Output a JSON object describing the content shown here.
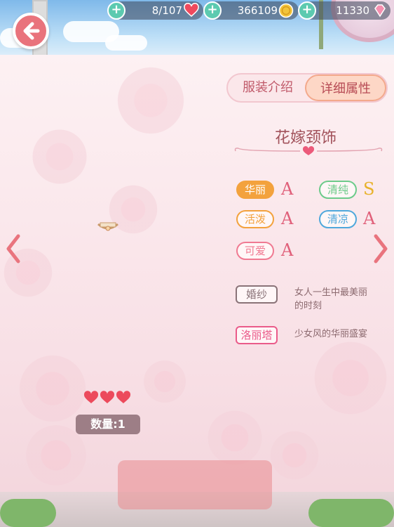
{
  "resources": {
    "stamina": "8/107",
    "coins": "366109",
    "diamonds": "11330"
  },
  "tabs": [
    {
      "label": "服装介绍",
      "active": false
    },
    {
      "label": "详细属性",
      "active": true
    }
  ],
  "item": {
    "name": "花嫁颈饰",
    "quantity_label": "数量:1",
    "hearts": 3
  },
  "attributes": [
    {
      "label": "华丽",
      "grade": "A",
      "color": "#f3a23d",
      "grade_color": "#e0607a"
    },
    {
      "label": "清纯",
      "grade": "S",
      "color": "#6ccb8a",
      "grade_color": "#e8b22a"
    },
    {
      "label": "活泼",
      "grade": "A",
      "color": "#f3a23d",
      "grade_color": "#e0607a"
    },
    {
      "label": "清凉",
      "grade": "A",
      "color": "#4fa8dc",
      "grade_color": "#e0607a"
    },
    {
      "label": "可爱",
      "grade": "A",
      "color": "#f07a92",
      "grade_color": "#e0607a"
    }
  ],
  "tags": [
    {
      "label": "婚纱",
      "desc": "女人一生中最美丽的时刻",
      "color": "#8a7378"
    },
    {
      "label": "洛丽塔",
      "desc": "少女风的华丽盛宴",
      "color": "#ea5b8a"
    }
  ],
  "icons": {
    "back": "back-arrow-icon",
    "prev": "chevron-left-icon",
    "next": "chevron-right-icon"
  },
  "colors": {
    "accent": "#e9737c",
    "title": "#a2525b"
  }
}
